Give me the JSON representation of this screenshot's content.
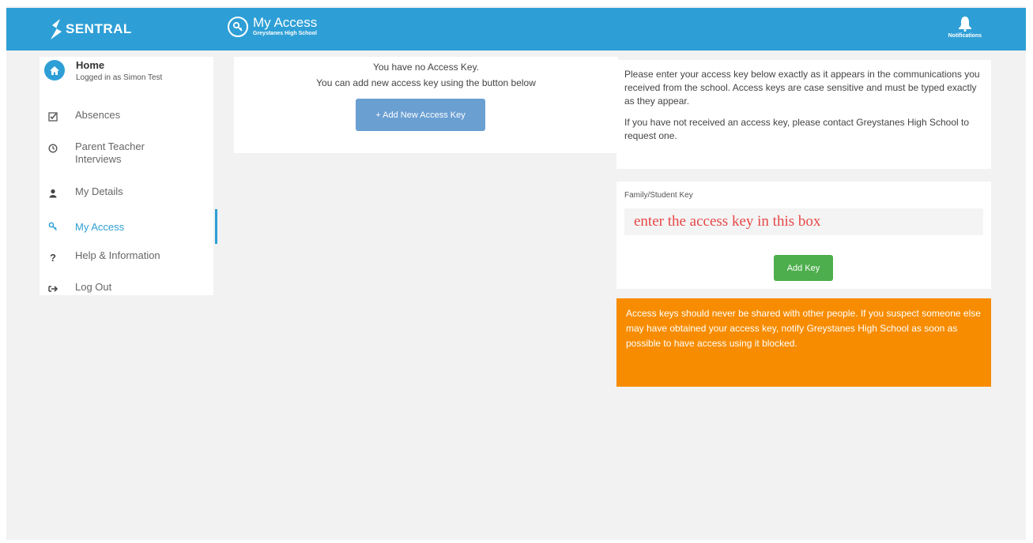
{
  "app": {
    "brand": "SENTRAL",
    "page_title": "My Access",
    "school": "Greystanes High School",
    "notifications_label": "Notifications"
  },
  "sidebar": {
    "home": {
      "title": "Home",
      "subtitle": "Logged in as Simon Test"
    },
    "items": [
      {
        "label": "Absences",
        "icon": "check-icon"
      },
      {
        "label": "Parent Teacher Interviews",
        "icon": "clock-icon"
      },
      {
        "label": "My Details",
        "icon": "user-icon"
      },
      {
        "label": "My Access",
        "icon": "key-icon",
        "active": true
      },
      {
        "label": "Help & Information",
        "icon": "question-icon"
      },
      {
        "label": "Log Out",
        "icon": "logout-icon"
      }
    ]
  },
  "access": {
    "no_key_text": "You have no Access Key.",
    "add_hint": "You can add new access key using the button below",
    "add_new_button": "+ Add New Access Key"
  },
  "info": {
    "para1": "Please enter your access key below exactly as it appears in the communications you received from the school. Access keys are case sensitive and must be typed exactly as they appear.",
    "para2": "If you have not received an access key, please contact Greystanes High School to request one."
  },
  "key_form": {
    "label": "Family/Student Key",
    "placeholder": "enter the access key in this box",
    "value": "",
    "submit_button": "Add Key"
  },
  "warning": {
    "text": "Access keys should never be shared with other people. If you suspect someone else may have obtained your access key, notify Greystanes High School as soon as possible to have access using it blocked."
  },
  "colors": {
    "header": "#2e9fd6",
    "add_new_button": "#6a9fd2",
    "add_key_button": "#4cae4c",
    "warning": "#f78c00",
    "placeholder_text": "#e74848"
  }
}
